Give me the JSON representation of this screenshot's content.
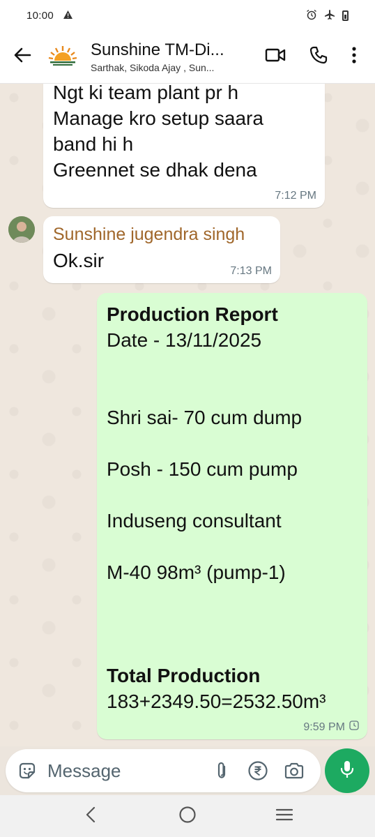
{
  "status_bar": {
    "time": "10:00",
    "left_icon": "warning-icon",
    "right_icons": [
      "alarm-icon",
      "airplane-icon",
      "battery-icon"
    ]
  },
  "header": {
    "title": "Sunshine TM-Di...",
    "subtitle": "Sarthak, Sikoda Ajay , Sun...",
    "icons": [
      "back-arrow-icon",
      "group-avatar",
      "video-call-icon",
      "phone-icon",
      "more-options-icon"
    ]
  },
  "messages": [
    {
      "direction": "incoming",
      "text": "Ngt ki team plant pr h\nManage kro setup saara\nband hi h\nGreennet se dhak dena",
      "time": "7:12 PM"
    },
    {
      "direction": "incoming",
      "sender": "Sunshine jugendra singh",
      "text": "Ok.sir",
      "time": "7:13 PM"
    },
    {
      "direction": "outgoing",
      "lines": [
        {
          "text": "Production Report",
          "bold": true
        },
        {
          "text": "Date - 13/11/2025",
          "bold": false
        },
        {
          "text": "",
          "bold": false
        },
        {
          "text": "",
          "bold": false
        },
        {
          "text": "Shri sai- 70 cum dump",
          "bold": false
        },
        {
          "text": "",
          "bold": false
        },
        {
          "text": "Posh - 150 cum pump",
          "bold": false
        },
        {
          "text": "",
          "bold": false
        },
        {
          "text": "Induseng consultant",
          "bold": false
        },
        {
          "text": "",
          "bold": false
        },
        {
          "text": "M-40 98m³  (pump-1)",
          "bold": false
        },
        {
          "text": "",
          "bold": false
        },
        {
          "text": "",
          "bold": false
        },
        {
          "text": "",
          "bold": false
        },
        {
          "text": "Total Production",
          "bold": true
        },
        {
          "text": "183+2349.50=2532.50m³",
          "bold": false
        }
      ],
      "time": "9:59 PM",
      "status_icon": "pending-clock-icon"
    }
  ],
  "input": {
    "placeholder": "Message",
    "icons": [
      "sticker-icon",
      "attach-icon",
      "rupee-payment-icon",
      "camera-icon",
      "mic-icon"
    ]
  },
  "nav": {
    "icons": [
      "nav-back-icon",
      "nav-home-icon",
      "nav-recents-icon"
    ]
  },
  "colors": {
    "outgoing_bubble": "#d9fdd3",
    "incoming_bubble": "#ffffff",
    "sender_name": "#a0672b",
    "mic_button": "#1daa61",
    "chat_background": "#efe7de"
  }
}
